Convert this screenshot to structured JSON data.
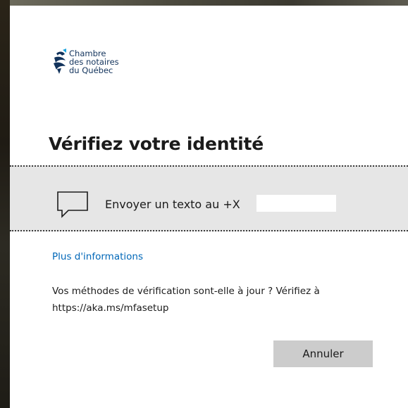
{
  "brand": {
    "logo_lines": [
      "Chambre",
      "des notaires",
      "du Québec"
    ],
    "colors": {
      "navy": "#12335c",
      "accent_blue": "#1aa3dd"
    }
  },
  "dialog": {
    "title": "Vérifiez votre identité",
    "method": {
      "icon": "chat-bubble-icon",
      "label": "Envoyer un texto au +X",
      "phone_number_redacted": true
    },
    "more_info_link": "Plus d'informations",
    "info_lines": [
      "Vos méthodes de vérification sont-elle à jour ? Vérifiez à",
      "https://aka.ms/mfasetup"
    ],
    "cancel_button": "Annuler"
  },
  "colors": {
    "link": "#0067b8",
    "method_row_bg": "#e6e6e6",
    "button_bg": "#cccccc",
    "text": "#1b1b1b"
  }
}
